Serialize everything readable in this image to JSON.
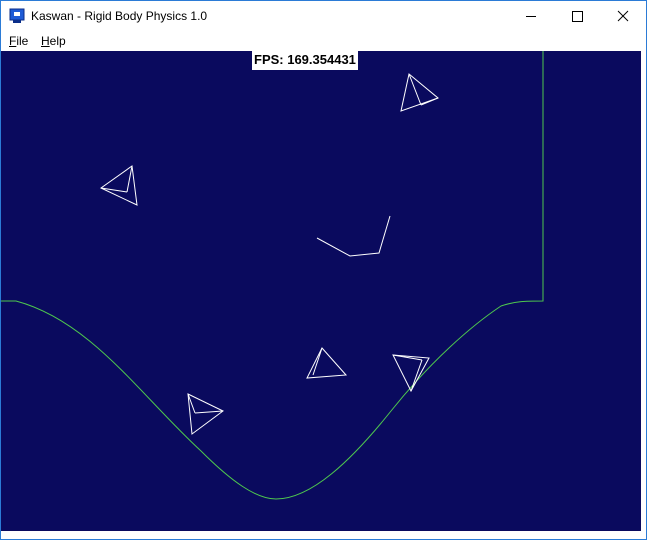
{
  "window": {
    "title": "Kaswan - Rigid Body Physics 1.0",
    "icon": "app-window-icon",
    "controls": [
      "minimize-icon",
      "maximize-icon",
      "close-icon"
    ]
  },
  "menu": {
    "file_rest": "ile",
    "file_accel": "F",
    "help_rest": "elp",
    "help_accel": "H"
  },
  "simulation": {
    "fps_label": "FPS: 169.354431",
    "background_color": "#0a0a5e",
    "terrain_color": "#4ec84e",
    "body_color": "#ffffff"
  }
}
